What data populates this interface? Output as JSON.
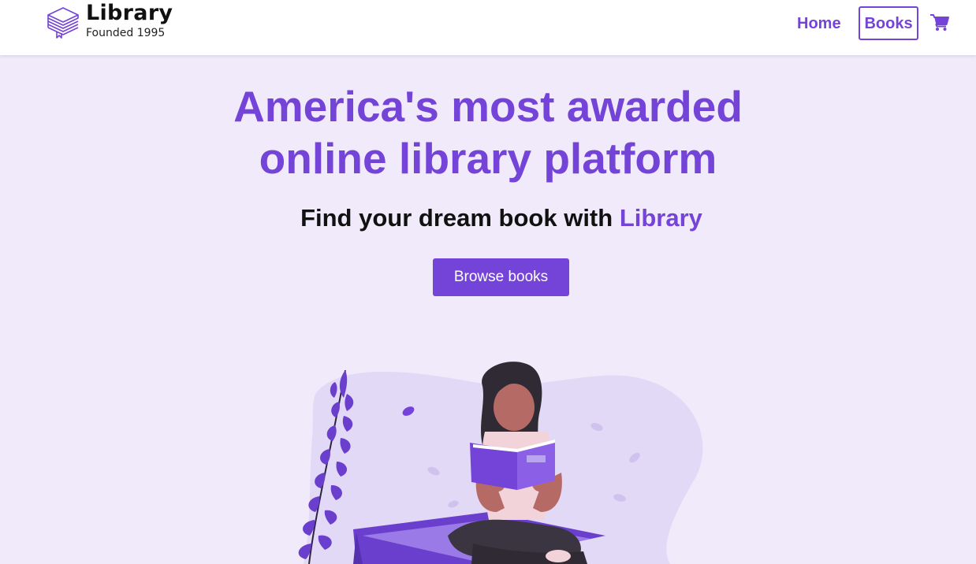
{
  "header": {
    "logo": {
      "title": "Library",
      "subtitle": "Founded 1995",
      "icon": "stacked-books-icon"
    },
    "nav": {
      "home": "Home",
      "books": "Books",
      "cart_icon": "shopping-cart-icon"
    }
  },
  "hero": {
    "title_line1": "America's most awarded",
    "title_line2": "online library platform",
    "subtitle_prefix": "Find your dream book with ",
    "subtitle_accent": "Library",
    "cta": "Browse books"
  },
  "colors": {
    "accent": "#7443d8",
    "background": "#f0eafb",
    "header": "#ffffff",
    "text": "#111111"
  }
}
